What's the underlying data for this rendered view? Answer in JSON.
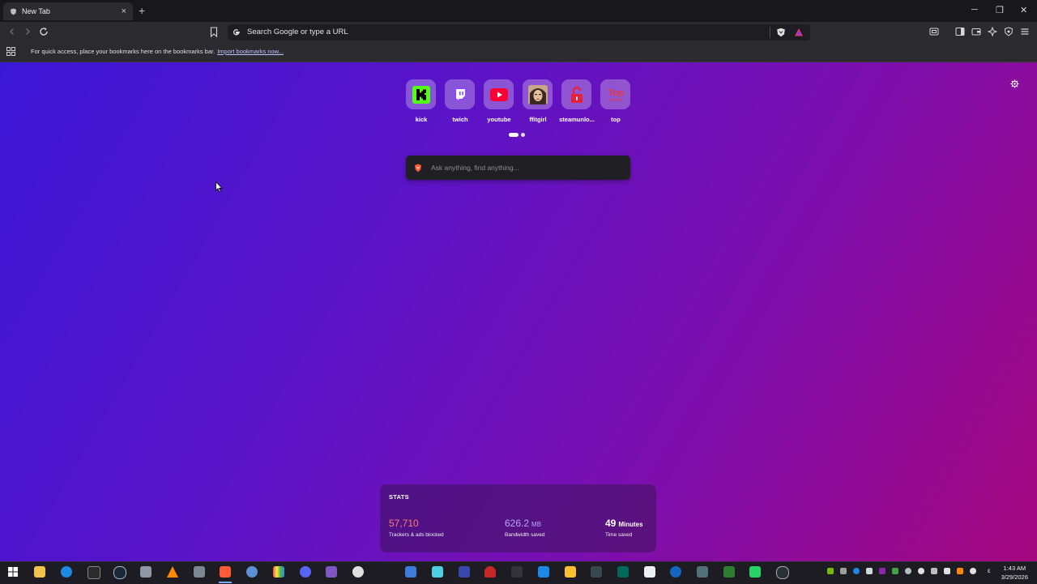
{
  "browser": {
    "tab_title": "New Tab",
    "tab_close": "×",
    "new_tab": "+",
    "address_placeholder": "Search Google or type a URL",
    "window": {
      "minimize": "─",
      "restore": "❐",
      "close": "✕"
    }
  },
  "bookmarks_bar": {
    "message": "For quick access, place your bookmarks here on the bookmarks bar.",
    "import_link": "Import bookmarks now..."
  },
  "top_sites": [
    {
      "label": "kick",
      "icon": "kick-icon",
      "color": "#53fc18"
    },
    {
      "label": "twich",
      "icon": "twitch-icon",
      "color": "#9146ff"
    },
    {
      "label": "youtube",
      "icon": "youtube-icon",
      "color": "#ff0033"
    },
    {
      "label": "ffitgirl",
      "icon": "fitgirl-avatar",
      "color": "#b07a55"
    },
    {
      "label": "steamunlo...",
      "icon": "unlock-icon",
      "color": "#e8213a"
    },
    {
      "label": "top",
      "icon": "top-cinema-icon",
      "color": "#d32f2f"
    }
  ],
  "search": {
    "placeholder": "Ask anything, find anything..."
  },
  "stats": {
    "header": "STATS",
    "trackers": {
      "value": "57,710",
      "label": "Trackers & ads blocked",
      "color": "#ff7a72"
    },
    "bandwidth": {
      "value": "626.2",
      "unit": "MB",
      "label": "Bandwidth saved",
      "color": "#b9a6ff"
    },
    "time": {
      "value": "49",
      "unit": "Minutes",
      "label": "Time saved",
      "color": "#ffffff"
    }
  },
  "taskbar": {
    "clock_time": "1:43 AM",
    "clock_date": "3/29/2026",
    "tray_lang": "ε",
    "apps": [
      "windows-start-icon",
      "file-explorer-icon",
      "edge-icon",
      "epic-games-icon",
      "steam-icon",
      "app-icon",
      "vlc-icon",
      "app-icon",
      "brave-icon",
      "app-icon",
      "app-icon",
      "discord-icon",
      "game-controller-icon",
      "steelseries-icon",
      "app-icon",
      "app-icon",
      "app-icon",
      "app-icon",
      "app-icon",
      "app-icon",
      "rockstar-icon",
      "app-icon",
      "terminal-icon",
      "app-icon",
      "app-icon",
      "app-icon",
      "app-icon",
      "whatsapp-icon",
      "app-icon"
    ]
  }
}
